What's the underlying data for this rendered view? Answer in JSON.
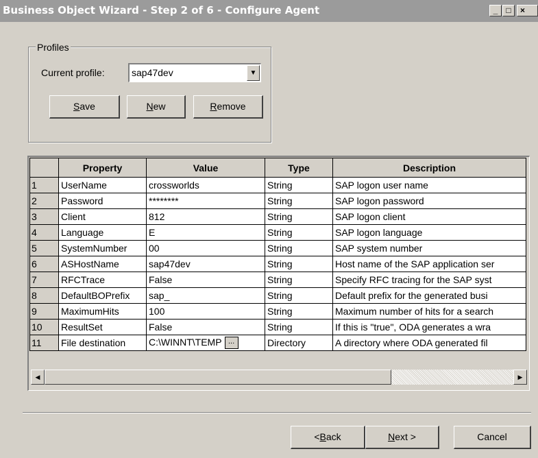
{
  "window": {
    "title": "Business Object Wizard - Step 2 of 6 - Configure Agent",
    "buttons": {
      "minimize": "_",
      "maximize": "□",
      "close": "×"
    }
  },
  "profiles": {
    "group_label": "Profiles",
    "current_label": "Current profile:",
    "current_value": "sap47dev",
    "save": {
      "mnemonic": "S",
      "rest": "ave"
    },
    "new": {
      "mnemonic": "N",
      "rest": "ew"
    },
    "remove": {
      "mnemonic": "R",
      "rest": "emove"
    }
  },
  "grid": {
    "headers": [
      "",
      "Property",
      "Value",
      "Type",
      "Description"
    ],
    "rows": [
      {
        "n": "1",
        "property": "UserName",
        "value": "crossworlds",
        "type": "String",
        "description": "SAP logon user name"
      },
      {
        "n": "2",
        "property": "Password",
        "value": "********",
        "type": "String",
        "description": "SAP logon password"
      },
      {
        "n": "3",
        "property": "Client",
        "value": "812",
        "type": "String",
        "description": "SAP logon client"
      },
      {
        "n": "4",
        "property": "Language",
        "value": "E",
        "type": "String",
        "description": "SAP logon language"
      },
      {
        "n": "5",
        "property": "SystemNumber",
        "value": "00",
        "type": "String",
        "description": "SAP system number"
      },
      {
        "n": "6",
        "property": "ASHostName",
        "value": "sap47dev",
        "type": "String",
        "description": "Host name of the SAP application ser"
      },
      {
        "n": "7",
        "property": "RFCTrace",
        "value": "False",
        "type": "String",
        "description": "Specify RFC tracing for the SAP syst"
      },
      {
        "n": "8",
        "property": "DefaultBOPrefix",
        "value": "sap_",
        "type": "String",
        "description": "Default prefix for the generated busi"
      },
      {
        "n": "9",
        "property": "MaximumHits",
        "value": "100",
        "type": "String",
        "description": "Maximum number of hits for a search"
      },
      {
        "n": "10",
        "property": "ResultSet",
        "value": "False",
        "type": "String",
        "description": "If this is \"true\", ODA generates a wra"
      },
      {
        "n": "11",
        "property": "File destination",
        "value": "C:\\WINNT\\TEMP",
        "type": "Directory",
        "description": "A directory where ODA generated fil"
      }
    ],
    "ellipsis": "..."
  },
  "footer": {
    "back": {
      "pre": "< ",
      "mnemonic": "B",
      "rest": "ack"
    },
    "next": {
      "mnemonic": "N",
      "rest": "ext >"
    },
    "cancel": "Cancel"
  }
}
